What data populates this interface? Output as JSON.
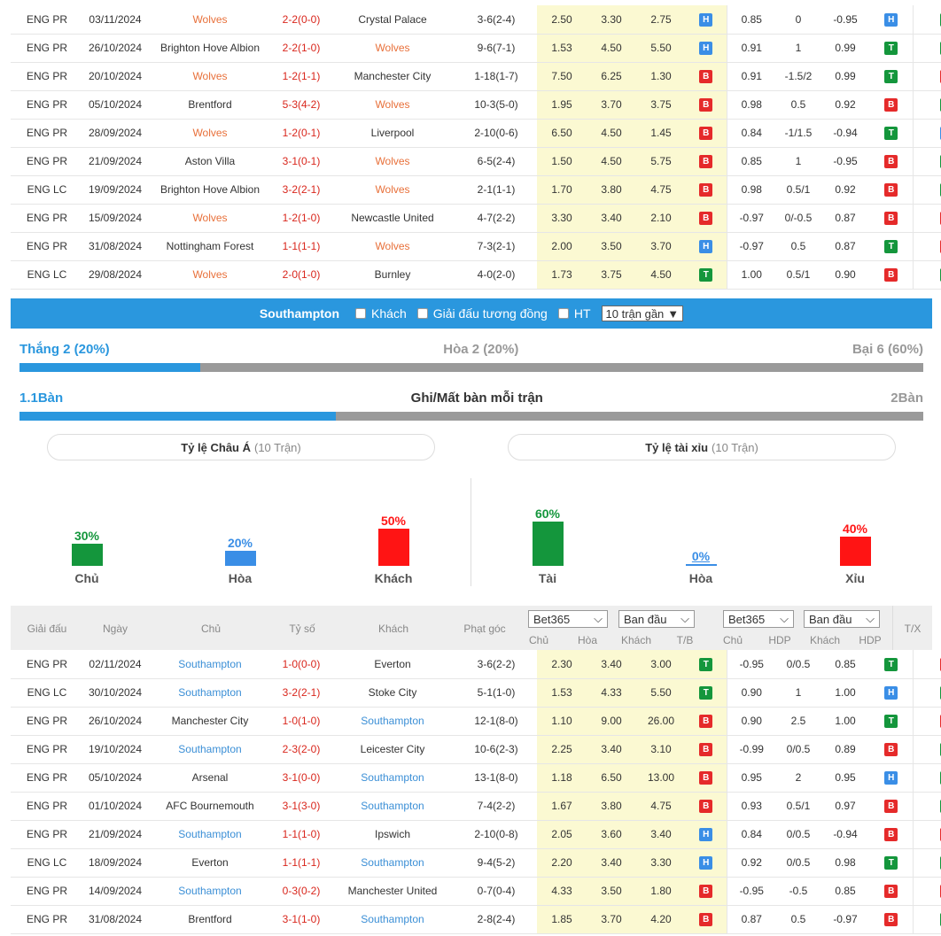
{
  "table_top": {
    "rows": [
      {
        "league": "ENG PR",
        "date": "03/11/2024",
        "home": "Wolves",
        "home_hl": true,
        "score": "2-2(0-0)",
        "away": "Crystal Palace",
        "away_hl": false,
        "corner": "3-6(2-4)",
        "o1": "2.50",
        "o2": "3.30",
        "o3": "2.75",
        "ou": "H",
        "hc1": "0.85",
        "hc2": "0",
        "hc3": "-0.95",
        "hdp": "H",
        "tx": "T"
      },
      {
        "league": "ENG PR",
        "date": "26/10/2024",
        "home": "Brighton Hove Albion",
        "home_hl": false,
        "score": "2-2(1-0)",
        "away": "Wolves",
        "away_hl": true,
        "corner": "9-6(7-1)",
        "o1": "1.53",
        "o2": "4.50",
        "o3": "5.50",
        "ou": "H",
        "hc1": "0.91",
        "hc2": "1",
        "hc3": "0.99",
        "hdp": "T",
        "tx": "T"
      },
      {
        "league": "ENG PR",
        "date": "20/10/2024",
        "home": "Wolves",
        "home_hl": true,
        "score": "1-2(1-1)",
        "away": "Manchester City",
        "away_hl": false,
        "corner": "1-18(1-7)",
        "o1": "7.50",
        "o2": "6.25",
        "o3": "1.30",
        "ou": "B",
        "hc1": "0.91",
        "hc2": "-1.5/2",
        "hc3": "0.99",
        "hdp": "T",
        "tx": "X"
      },
      {
        "league": "ENG PR",
        "date": "05/10/2024",
        "home": "Brentford",
        "home_hl": false,
        "score": "5-3(4-2)",
        "away": "Wolves",
        "away_hl": true,
        "corner": "10-3(5-0)",
        "o1": "1.95",
        "o2": "3.70",
        "o3": "3.75",
        "ou": "B",
        "hc1": "0.98",
        "hc2": "0.5",
        "hc3": "0.92",
        "hdp": "B",
        "tx": "T"
      },
      {
        "league": "ENG PR",
        "date": "28/09/2024",
        "home": "Wolves",
        "home_hl": true,
        "score": "1-2(0-1)",
        "away": "Liverpool",
        "away_hl": false,
        "corner": "2-10(0-6)",
        "o1": "6.50",
        "o2": "4.50",
        "o3": "1.45",
        "ou": "B",
        "hc1": "0.84",
        "hc2": "-1/1.5",
        "hc3": "-0.94",
        "hdp": "T",
        "tx": "H"
      },
      {
        "league": "ENG PR",
        "date": "21/09/2024",
        "home": "Aston Villa",
        "home_hl": false,
        "score": "3-1(0-1)",
        "away": "Wolves",
        "away_hl": true,
        "corner": "6-5(2-4)",
        "o1": "1.50",
        "o2": "4.50",
        "o3": "5.75",
        "ou": "B",
        "hc1": "0.85",
        "hc2": "1",
        "hc3": "-0.95",
        "hdp": "B",
        "tx": "T"
      },
      {
        "league": "ENG LC",
        "date": "19/09/2024",
        "home": "Brighton Hove Albion",
        "home_hl": false,
        "score": "3-2(2-1)",
        "away": "Wolves",
        "away_hl": true,
        "corner": "2-1(1-1)",
        "o1": "1.70",
        "o2": "3.80",
        "o3": "4.75",
        "ou": "B",
        "hc1": "0.98",
        "hc2": "0.5/1",
        "hc3": "0.92",
        "hdp": "B",
        "tx": "T"
      },
      {
        "league": "ENG PR",
        "date": "15/09/2024",
        "home": "Wolves",
        "home_hl": true,
        "score": "1-2(1-0)",
        "away": "Newcastle United",
        "away_hl": false,
        "corner": "4-7(2-2)",
        "o1": "3.30",
        "o2": "3.40",
        "o3": "2.10",
        "ou": "B",
        "hc1": "-0.97",
        "hc2": "0/-0.5",
        "hc3": "0.87",
        "hdp": "B",
        "tx": "X"
      },
      {
        "league": "ENG PR",
        "date": "31/08/2024",
        "home": "Nottingham Forest",
        "home_hl": false,
        "score": "1-1(1-1)",
        "away": "Wolves",
        "away_hl": true,
        "corner": "7-3(2-1)",
        "o1": "2.00",
        "o2": "3.50",
        "o3": "3.70",
        "ou": "H",
        "hc1": "-0.97",
        "hc2": "0.5",
        "hc3": "0.87",
        "hdp": "T",
        "tx": "X"
      },
      {
        "league": "ENG LC",
        "date": "29/08/2024",
        "home": "Wolves",
        "home_hl": true,
        "score": "2-0(1-0)",
        "away": "Burnley",
        "away_hl": false,
        "corner": "4-0(2-0)",
        "o1": "1.73",
        "o2": "3.75",
        "o3": "4.50",
        "ou": "T",
        "hc1": "1.00",
        "hc2": "0.5/1",
        "hc3": "0.90",
        "hdp": "B",
        "tx": "T"
      }
    ]
  },
  "filter_bar": {
    "team": "Southampton",
    "opt_away": "Khách",
    "opt_same_league": "Giải đấu tương đồng",
    "opt_ht": "HT",
    "select_value": "10 trận gần"
  },
  "summary": {
    "win": "Thắng 2 (20%)",
    "draw": "Hòa 2 (20%)",
    "loss": "Bại 6 (60%)",
    "win_fraction": 0.2,
    "goals_for": "1.1Bàn",
    "goals_title": "Ghi/Mất bàn mỗi trận",
    "goals_against": "2Bàn",
    "goals_fraction": 0.35
  },
  "asian": {
    "title": "Tỷ lệ Châu Á",
    "count": "(10 Trận)",
    "bars": [
      {
        "pct": "30%",
        "label": "Chủ",
        "value": 30,
        "color": "#14963c"
      },
      {
        "pct": "20%",
        "label": "Hòa",
        "value": 20,
        "color": "#3a8ee6"
      },
      {
        "pct": "50%",
        "label": "Khách",
        "value": 50,
        "color": "#ff1414"
      }
    ]
  },
  "overunder": {
    "title": "Tỷ lệ tài xỉu",
    "count": "(10 Trận)",
    "bars": [
      {
        "pct": "60%",
        "label": "Tài",
        "value": 60,
        "color": "#14963c"
      },
      {
        "pct": "0%",
        "label": "Hòa",
        "value": 0,
        "color": "#3a8ee6"
      },
      {
        "pct": "40%",
        "label": "Xỉu",
        "value": 40,
        "color": "#ff1414"
      }
    ]
  },
  "table_bottom": {
    "headers": {
      "league": "Giải đấu",
      "date": "Ngày",
      "home": "Chủ",
      "score": "Tỷ số",
      "away": "Khách",
      "corner": "Phạt góc",
      "bookmaker1": "Bet365",
      "type1": "Ban đầu",
      "bookmaker2": "Bet365",
      "type2": "Ban đầu",
      "c_home": "Chủ",
      "c_draw": "Hòa",
      "c_away": "Khách",
      "c_tb": "T/B",
      "c_home2": "Chủ",
      "c_hdp": "HDP",
      "c_away2": "Khách",
      "c_hdp2": "HDP",
      "tx": "T/X"
    },
    "rows": [
      {
        "league": "ENG PR",
        "date": "02/11/2024",
        "home": "Southampton",
        "home_hl": true,
        "score": "1-0(0-0)",
        "away": "Everton",
        "away_hl": false,
        "corner": "3-6(2-2)",
        "o1": "2.30",
        "o2": "3.40",
        "o3": "3.00",
        "ou": "T",
        "hc1": "-0.95",
        "hc2": "0/0.5",
        "hc3": "0.85",
        "hdp": "T",
        "tx": "X"
      },
      {
        "league": "ENG LC",
        "date": "30/10/2024",
        "home": "Southampton",
        "home_hl": true,
        "score": "3-2(2-1)",
        "away": "Stoke City",
        "away_hl": false,
        "corner": "5-1(1-0)",
        "o1": "1.53",
        "o2": "4.33",
        "o3": "5.50",
        "ou": "T",
        "hc1": "0.90",
        "hc2": "1",
        "hc3": "1.00",
        "hdp": "H",
        "tx": "T"
      },
      {
        "league": "ENG PR",
        "date": "26/10/2024",
        "home": "Manchester City",
        "home_hl": false,
        "score": "1-0(1-0)",
        "away": "Southampton",
        "away_hl": true,
        "corner": "12-1(8-0)",
        "o1": "1.10",
        "o2": "9.00",
        "o3": "26.00",
        "ou": "B",
        "hc1": "0.90",
        "hc2": "2.5",
        "hc3": "1.00",
        "hdp": "T",
        "tx": "X"
      },
      {
        "league": "ENG PR",
        "date": "19/10/2024",
        "home": "Southampton",
        "home_hl": true,
        "score": "2-3(2-0)",
        "away": "Leicester City",
        "away_hl": false,
        "corner": "10-6(2-3)",
        "o1": "2.25",
        "o2": "3.40",
        "o3": "3.10",
        "ou": "B",
        "hc1": "-0.99",
        "hc2": "0/0.5",
        "hc3": "0.89",
        "hdp": "B",
        "tx": "T"
      },
      {
        "league": "ENG PR",
        "date": "05/10/2024",
        "home": "Arsenal",
        "home_hl": false,
        "score": "3-1(0-0)",
        "away": "Southampton",
        "away_hl": true,
        "corner": "13-1(8-0)",
        "o1": "1.18",
        "o2": "6.50",
        "o3": "13.00",
        "ou": "B",
        "hc1": "0.95",
        "hc2": "2",
        "hc3": "0.95",
        "hdp": "H",
        "tx": "T"
      },
      {
        "league": "ENG PR",
        "date": "01/10/2024",
        "home": "AFC Bournemouth",
        "home_hl": false,
        "score": "3-1(3-0)",
        "away": "Southampton",
        "away_hl": true,
        "corner": "7-4(2-2)",
        "o1": "1.67",
        "o2": "3.80",
        "o3": "4.75",
        "ou": "B",
        "hc1": "0.93",
        "hc2": "0.5/1",
        "hc3": "0.97",
        "hdp": "B",
        "tx": "T"
      },
      {
        "league": "ENG PR",
        "date": "21/09/2024",
        "home": "Southampton",
        "home_hl": true,
        "score": "1-1(1-0)",
        "away": "Ipswich",
        "away_hl": false,
        "corner": "2-10(0-8)",
        "o1": "2.05",
        "o2": "3.60",
        "o3": "3.40",
        "ou": "H",
        "hc1": "0.84",
        "hc2": "0/0.5",
        "hc3": "-0.94",
        "hdp": "B",
        "tx": "X"
      },
      {
        "league": "ENG LC",
        "date": "18/09/2024",
        "home": "Everton",
        "home_hl": false,
        "score": "1-1(1-1)",
        "away": "Southampton",
        "away_hl": true,
        "corner": "9-4(5-2)",
        "o1": "2.20",
        "o2": "3.40",
        "o3": "3.30",
        "ou": "H",
        "hc1": "0.92",
        "hc2": "0/0.5",
        "hc3": "0.98",
        "hdp": "T",
        "tx": "T"
      },
      {
        "league": "ENG PR",
        "date": "14/09/2024",
        "home": "Southampton",
        "home_hl": true,
        "score": "0-3(0-2)",
        "away": "Manchester United",
        "away_hl": false,
        "corner": "0-7(0-4)",
        "o1": "4.33",
        "o2": "3.50",
        "o3": "1.80",
        "ou": "B",
        "hc1": "-0.95",
        "hc2": "-0.5",
        "hc3": "0.85",
        "hdp": "B",
        "tx": "X"
      },
      {
        "league": "ENG PR",
        "date": "31/08/2024",
        "home": "Brentford",
        "home_hl": false,
        "score": "3-1(1-0)",
        "away": "Southampton",
        "away_hl": true,
        "corner": "2-8(2-4)",
        "o1": "1.85",
        "o2": "3.70",
        "o3": "4.20",
        "ou": "B",
        "hc1": "0.87",
        "hc2": "0.5",
        "hc3": "-0.97",
        "hdp": "B",
        "tx": "T"
      }
    ]
  }
}
